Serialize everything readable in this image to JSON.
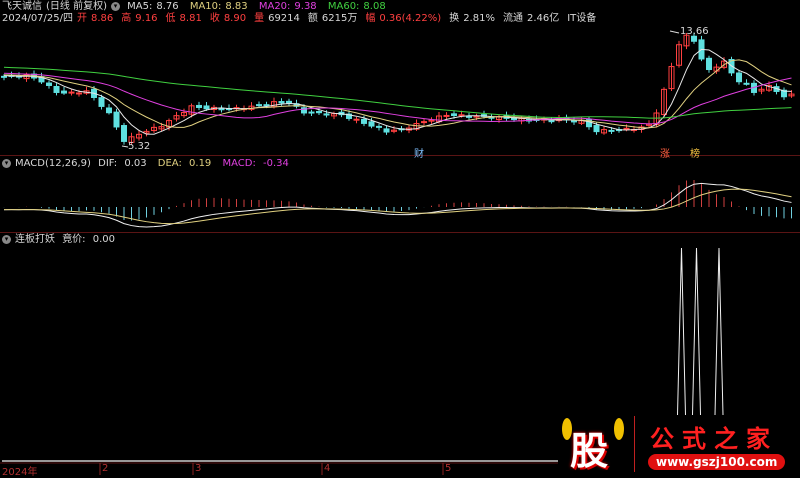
{
  "header": {
    "stock_name": "飞天诚信",
    "period": "(日线 前复权)",
    "ma": [
      {
        "label": "MA5:",
        "value": "8.76",
        "color": "#e8e8e8"
      },
      {
        "label": "MA10:",
        "value": "8.83",
        "color": "#e0d080"
      },
      {
        "label": "MA20:",
        "value": "9.38",
        "color": "#e040e0"
      },
      {
        "label": "MA60:",
        "value": "8.08",
        "color": "#40d040"
      }
    ],
    "date": "2024/07/25/四",
    "open_label": "开",
    "open": "8.86",
    "high_label": "高",
    "high": "9.16",
    "low_label": "低",
    "low": "8.81",
    "close_label": "收",
    "close": "8.90",
    "volume_label": "量",
    "volume": "69214",
    "amount_label": "额",
    "amount": "6215万",
    "change_label": "幅",
    "change": "0.36(4.22%)",
    "turnover_label": "换",
    "turnover": "2.81%",
    "float_label": "流通",
    "float_cap": "2.46亿",
    "industry": "IT设备"
  },
  "price_marks": {
    "max": "13.66",
    "min": "5.32"
  },
  "event_marks": [
    {
      "text": "财",
      "color": "#80c0ff"
    },
    {
      "text": "涨",
      "color": "#ff6040"
    },
    {
      "text": "榜",
      "color": "#f0c040"
    }
  ],
  "macd": {
    "title": "MACD(12,26,9)",
    "dif_label": "DIF:",
    "dif": "0.03",
    "dea_label": "DEA:",
    "dea": "0.19",
    "macd_label": "MACD:",
    "macd": "-0.34"
  },
  "indicator": {
    "title": "连板打妖",
    "label": "竟价:",
    "value": "0.00",
    "signal_bars": [
      91,
      93,
      96
    ]
  },
  "time_axis": [
    "2024年",
    "2",
    "3",
    "4",
    "5"
  ],
  "watermark": {
    "char": "股",
    "title": "公式之家",
    "url": "www.gszj100.com"
  },
  "chart_data": {
    "type": "candlestick",
    "bars": 106,
    "price_range": [
      5.32,
      13.66
    ],
    "close_keypoints": [
      [
        0,
        10.19
      ],
      [
        3,
        10.3
      ],
      [
        5,
        9.9
      ],
      [
        7,
        9.08
      ],
      [
        9,
        9.0
      ],
      [
        11,
        9.16
      ],
      [
        13,
        8.1
      ],
      [
        14,
        7.5
      ],
      [
        15,
        6.5
      ],
      [
        16,
        5.5
      ],
      [
        17,
        5.7
      ],
      [
        18,
        6.0
      ],
      [
        21,
        6.6
      ],
      [
        23,
        7.3
      ],
      [
        25,
        8.0
      ],
      [
        27,
        7.9
      ],
      [
        30,
        7.8
      ],
      [
        33,
        8.0
      ],
      [
        36,
        8.3
      ],
      [
        38,
        8.3
      ],
      [
        40,
        7.6
      ],
      [
        42,
        7.5
      ],
      [
        45,
        7.4
      ],
      [
        47,
        7.0
      ],
      [
        49,
        6.6
      ],
      [
        51,
        6.2
      ],
      [
        53,
        6.3
      ],
      [
        56,
        6.9
      ],
      [
        59,
        7.4
      ],
      [
        62,
        7.3
      ],
      [
        66,
        7.2
      ],
      [
        70,
        7.0
      ],
      [
        74,
        7.05
      ],
      [
        77,
        6.9
      ],
      [
        79,
        6.2
      ],
      [
        82,
        6.3
      ],
      [
        85,
        6.45
      ],
      [
        86,
        6.7
      ],
      [
        87,
        7.6
      ],
      [
        88,
        9.2
      ],
      [
        89,
        11.0
      ],
      [
        90,
        12.6
      ],
      [
        91,
        13.2
      ],
      [
        92,
        12.9
      ],
      [
        93,
        11.5
      ],
      [
        94,
        10.7
      ],
      [
        95,
        11.0
      ],
      [
        96,
        11.3
      ],
      [
        97,
        10.5
      ],
      [
        98,
        9.9
      ],
      [
        99,
        9.6
      ],
      [
        100,
        9.1
      ],
      [
        101,
        9.3
      ],
      [
        102,
        9.5
      ],
      [
        103,
        9.2
      ],
      [
        104,
        8.7
      ],
      [
        105,
        8.9
      ]
    ]
  }
}
